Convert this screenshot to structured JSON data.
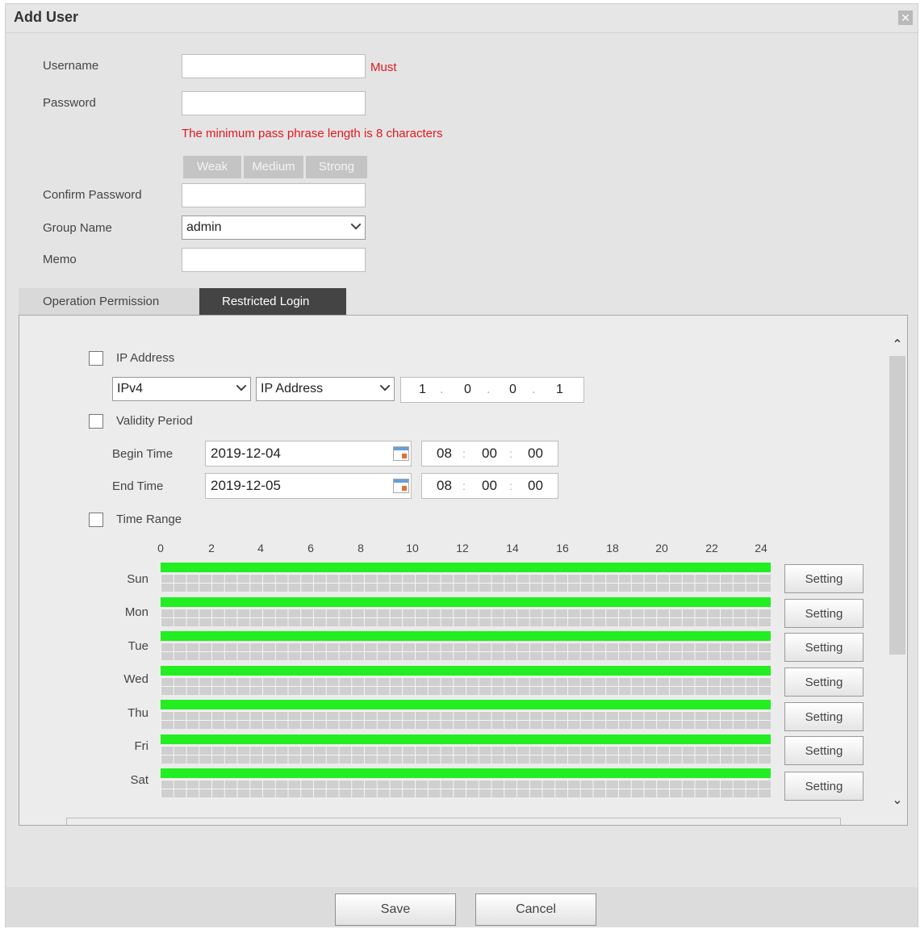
{
  "dialog": {
    "title": "Add User",
    "close_glyph": "✕"
  },
  "form": {
    "username_label": "Username",
    "username_value": "",
    "must_text": "Must",
    "password_label": "Password",
    "password_value": "",
    "password_hint": "The minimum pass phrase length is 8 characters",
    "strength": [
      "Weak",
      "Medium",
      "Strong"
    ],
    "confirm_label": "Confirm Password",
    "confirm_value": "",
    "group_label": "Group Name",
    "group_value": "admin",
    "memo_label": "Memo",
    "memo_value": ""
  },
  "tabs": [
    "Operation Permission",
    "Restricted Login"
  ],
  "restricted": {
    "ip_label": "IP Address",
    "ip_version": "IPv4",
    "ip_type": "IP Address",
    "ip_octets": [
      "1",
      "0",
      "0",
      "1"
    ],
    "validity_label": "Validity Period",
    "begin_label": "Begin Time",
    "begin_date": "2019-12-04",
    "begin_time": [
      "08",
      "00",
      "00"
    ],
    "end_label": "End Time",
    "end_date": "2019-12-05",
    "end_time": [
      "08",
      "00",
      "00"
    ],
    "time_range_label": "Time Range",
    "hours": [
      "0",
      "2",
      "4",
      "6",
      "8",
      "10",
      "12",
      "14",
      "16",
      "18",
      "20",
      "22",
      "24"
    ],
    "days": [
      "Sun",
      "Mon",
      "Tue",
      "Wed",
      "Thu",
      "Fri",
      "Sat"
    ],
    "setting_label": "Setting",
    "active_color": "#22ee22"
  },
  "footer": {
    "save_label": "Save",
    "cancel_label": "Cancel"
  }
}
